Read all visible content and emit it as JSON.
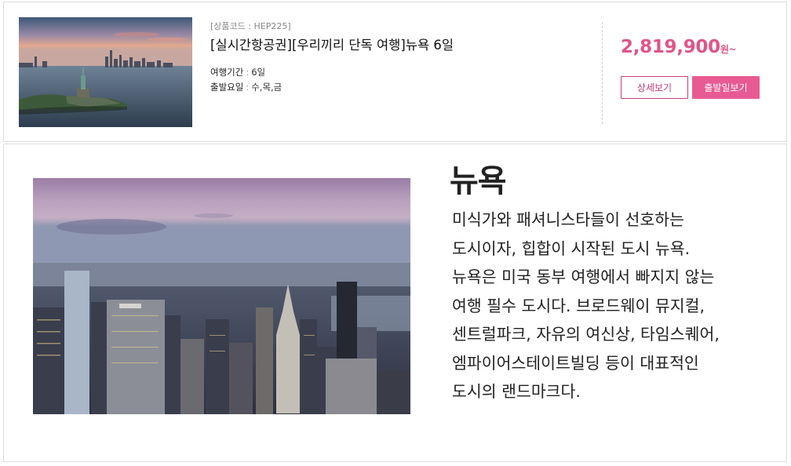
{
  "product": {
    "code": "[상품코드 : HEP225]",
    "title": "[실시간항공권][우리끼리 단독 여행]뉴욕 6일",
    "duration_label": "여행기간",
    "duration_value": "6일",
    "departure_label": "출발요일",
    "departure_value": "수,목,금",
    "price": "2,819,900",
    "price_unit": "원~",
    "detail_button": "상세보기",
    "departure_button": "출발일보기"
  },
  "city": {
    "name": "뉴욕",
    "description_lines": [
      "미식가와 패셔니스타들이 선호하는",
      "도시이자, 힙합이 시작된 도시 뉴욕.",
      "뉴욕은 미국 동부 여행에서 빠지지 않는",
      "여행 필수 도시다. 브로드웨이 뮤지컬,",
      "센트럴파크, 자유의 여신상, 타임스퀘어,",
      "엠파이어스테이트빌딩 등이 대표적인",
      "도시의 랜드마크다."
    ]
  },
  "colors": {
    "accent": "#e85b92",
    "accent_dark": "#c93c7c",
    "price": "#e0558a"
  }
}
